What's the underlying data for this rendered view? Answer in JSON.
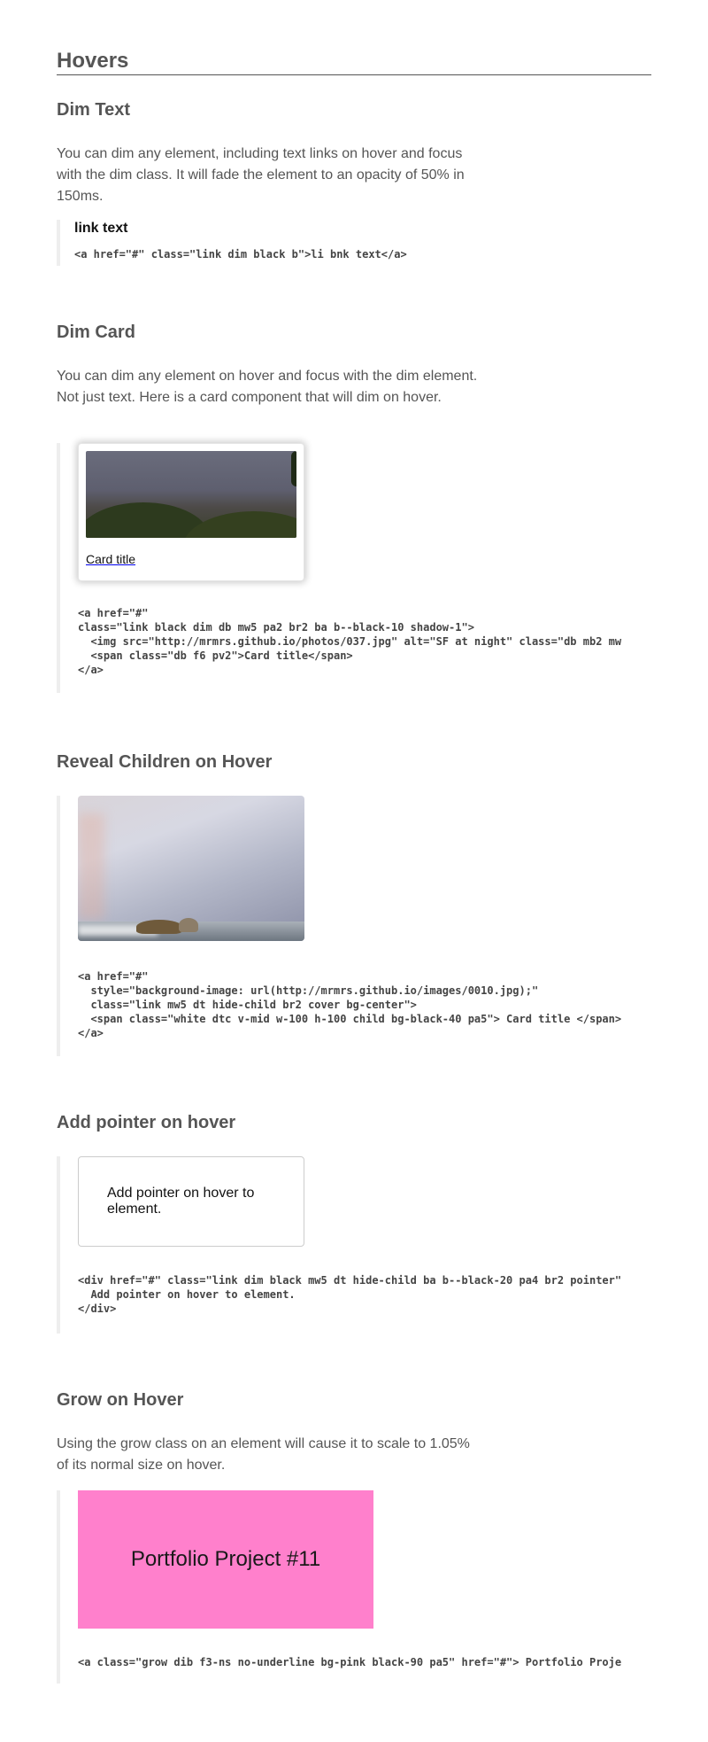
{
  "page": {
    "title": "Hovers"
  },
  "dim_text": {
    "heading": "Dim Text",
    "description": "You can dim any element, including text links on hover and focus with the dim class. It will fade the element to an opacity of 50% in 150ms.",
    "link_label": "link text",
    "code": "<a href=\"#\" class=\"link dim black b\">li bnk text</a>"
  },
  "dim_card": {
    "heading": "Dim Card",
    "description": "You can dim any element on hover and focus with the dim element. Not just text. Here is a card component that will dim on hover.",
    "card_title": "Card title",
    "code": "<a href=\"#\"\nclass=\"link black dim db mw5 pa2 br2 ba b--black-10 shadow-1\">\n  <img src=\"http://mrmrs.github.io/photos/037.jpg\" alt=\"SF at night\" class=\"db mb2 mw\n  <span class=\"db f6 pv2\">Card title</span>\n</a>"
  },
  "reveal": {
    "heading": "Reveal Children on Hover",
    "code": "<a href=\"#\"\n  style=\"background-image: url(http://mrmrs.github.io/images/0010.jpg);\"\n  class=\"link mw5 dt hide-child br2 cover bg-center\">\n  <span class=\"white dtc v-mid w-100 h-100 child bg-black-40 pa5\"> Card title </span>\n</a>"
  },
  "pointer": {
    "heading": "Add pointer on hover",
    "box_text": "Add pointer on hover to element.",
    "code": "<div href=\"#\" class=\"link dim black mw5 dt hide-child ba b--black-20 pa4 br2 pointer\"\n  Add pointer on hover to element.\n</div>"
  },
  "grow": {
    "heading": "Grow on Hover",
    "description": "Using the grow class on an element will cause it to scale to 1.05% of its normal size on hover.",
    "box_text": "Portfolio Project #11",
    "code": "<a class=\"grow dib f3-ns no-underline bg-pink black-90 pa5\" href=\"#\"> Portfolio Proje"
  },
  "colors": {
    "text": "#555555",
    "code_border": "#eeeeee",
    "pink": "#ff80cc"
  }
}
